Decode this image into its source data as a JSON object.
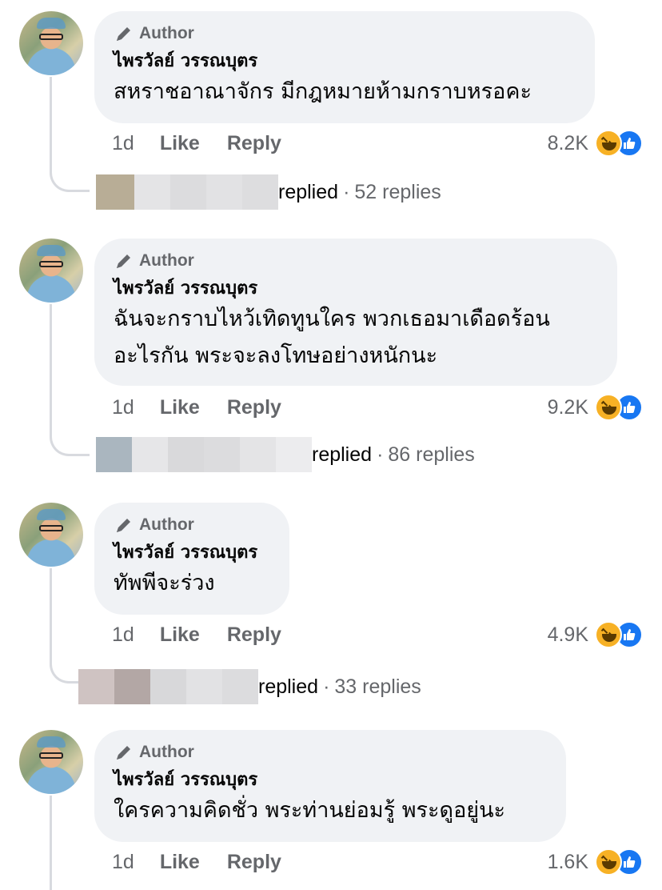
{
  "comments": [
    {
      "author_label": "Author",
      "name": "ไพรวัลย์ วรรณบุตร",
      "lines": [
        "สหราชอาณาจักร มีกฎหมายห้ามกราบหรอคะ"
      ],
      "time": "1d",
      "like": "Like",
      "reply": "Reply",
      "reaction_count": "8.2K",
      "replied": "replied",
      "reply_count": "52 replies"
    },
    {
      "author_label": "Author",
      "name": "ไพรวัลย์ วรรณบุตร",
      "lines": [
        "ฉันจะกราบไหว้เทิดทูนใคร พวกเธอมาเดือดร้อน",
        "อะไรกัน พระจะลงโทษอย่างหนักนะ"
      ],
      "time": "1d",
      "like": "Like",
      "reply": "Reply",
      "reaction_count": "9.2K",
      "replied": "replied",
      "reply_count": "86 replies"
    },
    {
      "author_label": "Author",
      "name": "ไพรวัลย์ วรรณบุตร",
      "lines": [
        "ทัพพีจะร่วง"
      ],
      "time": "1d",
      "like": "Like",
      "reply": "Reply",
      "reaction_count": "4.9K",
      "replied": "replied",
      "reply_count": "33 replies"
    },
    {
      "author_label": "Author",
      "name": "ไพรวัลย์ วรรณบุตร",
      "lines": [
        "ใครความคิดชั่ว พระท่านย่อมรู้ พระดูอยู่นะ"
      ],
      "time": "1d",
      "like": "Like",
      "reply": "Reply",
      "reaction_count": "1.6K"
    }
  ],
  "icons": {
    "author": "pen-icon",
    "reactions": [
      "haha-icon",
      "like-icon"
    ],
    "avatar": "profile-photo"
  },
  "colors": {
    "bubble": "#f0f2f5",
    "secondary_text": "#65676b",
    "like_blue": "#1877f2",
    "haha_yellow": "#f7b125"
  }
}
